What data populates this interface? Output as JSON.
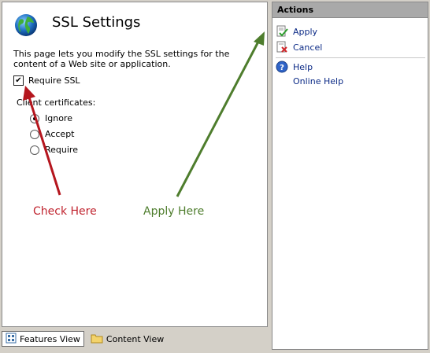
{
  "header": {
    "title": "SSL Settings",
    "icon": "globe-icon"
  },
  "description": "This page lets you modify the SSL settings for the content of a Web site or application.",
  "require_ssl": {
    "label": "Require SSL",
    "checked": true
  },
  "client_certificates": {
    "label": "Client certificates:",
    "options": [
      {
        "label": "Ignore",
        "selected": true
      },
      {
        "label": "Accept",
        "selected": false
      },
      {
        "label": "Require",
        "selected": false
      }
    ]
  },
  "annotations": {
    "check_text": "Check Here",
    "check_color": "#c0242f",
    "apply_text": "Apply Here",
    "apply_color": "#4e7d2d"
  },
  "views": {
    "features_label": "Features View",
    "content_label": "Content View",
    "active": "Features View"
  },
  "actions": {
    "title": "Actions",
    "items": [
      {
        "label": "Apply",
        "icon": "apply-icon"
      },
      {
        "label": "Cancel",
        "icon": "cancel-icon"
      },
      {
        "label": "Help",
        "icon": "help-icon"
      },
      {
        "label": "Online Help",
        "icon": ""
      }
    ]
  }
}
